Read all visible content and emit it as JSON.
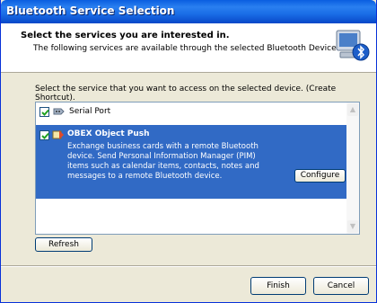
{
  "window": {
    "title": "Bluetooth Service Selection"
  },
  "header": {
    "title": "Select the services you are interested in.",
    "subtitle": "The following services are available through the selected Bluetooth Device.",
    "icon": "bluetooth-computer-icon"
  },
  "instruction": "Select the service that you want to access on the selected device. (Create Shortcut).",
  "services": [
    {
      "label": "Serial Port",
      "checked": true,
      "icon": "serial-port-icon"
    },
    {
      "label": "OBEX Object Push",
      "checked": true,
      "icon": "object-push-icon",
      "description": "Exchange business cards with a remote Bluetooth device. Send Personal Information Manager (PIM) items such as calendar items, contacts, notes and messages to a remote Bluetooth device.",
      "configure_label": "Configure"
    }
  ],
  "buttons": {
    "refresh": "Refresh",
    "finish": "Finish",
    "cancel": "Cancel"
  },
  "colors": {
    "titlebar": "#0a5ee0",
    "selection": "#316ac5",
    "dialog_bg": "#ece9d8"
  }
}
